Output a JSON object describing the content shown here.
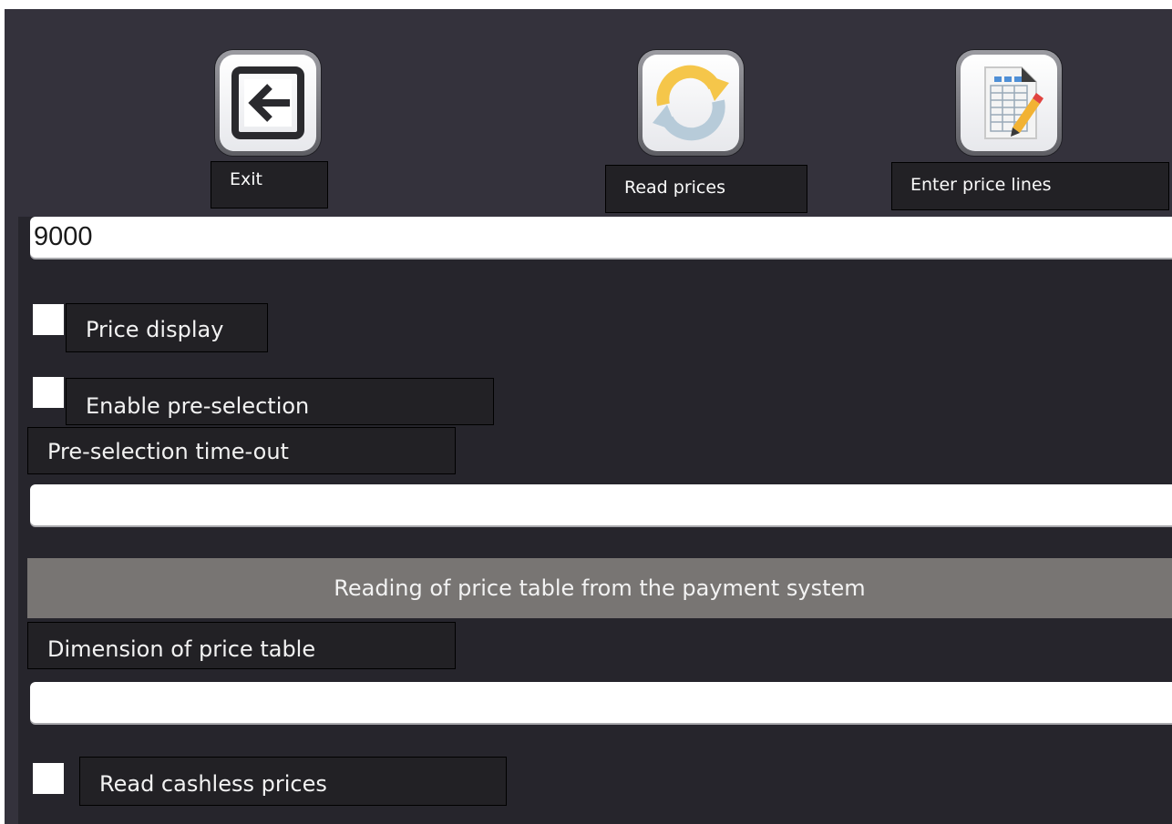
{
  "toolbar": {
    "exit_label": "Exit",
    "read_prices_label": "Read prices",
    "enter_price_lines_label": "Enter price lines"
  },
  "form": {
    "price_field_value": "9000",
    "price_display": {
      "label": "Price display",
      "checked": false
    },
    "enable_preselection": {
      "label": "Enable pre-selection",
      "checked": false
    },
    "preselection_timeout": {
      "label": "Pre-selection time-out",
      "value": ""
    },
    "section_header": "Reading of price table from the payment system",
    "dimension_price_table": {
      "label": "Dimension of price table",
      "value": ""
    },
    "read_cashless_prices": {
      "label": "Read cashless prices",
      "checked": false
    }
  },
  "colors": {
    "window_bg": "#34323c",
    "panel_bg": "#26252c",
    "label_bg": "#222125",
    "section_header_bg": "#787573",
    "refresh_icon_yellow": "#f5c64a",
    "refresh_icon_blue": "#b7cbd9"
  },
  "icons": {
    "exit": "exit-arrow-icon",
    "read_prices": "refresh-icon",
    "enter_price_lines": "table-edit-icon"
  }
}
